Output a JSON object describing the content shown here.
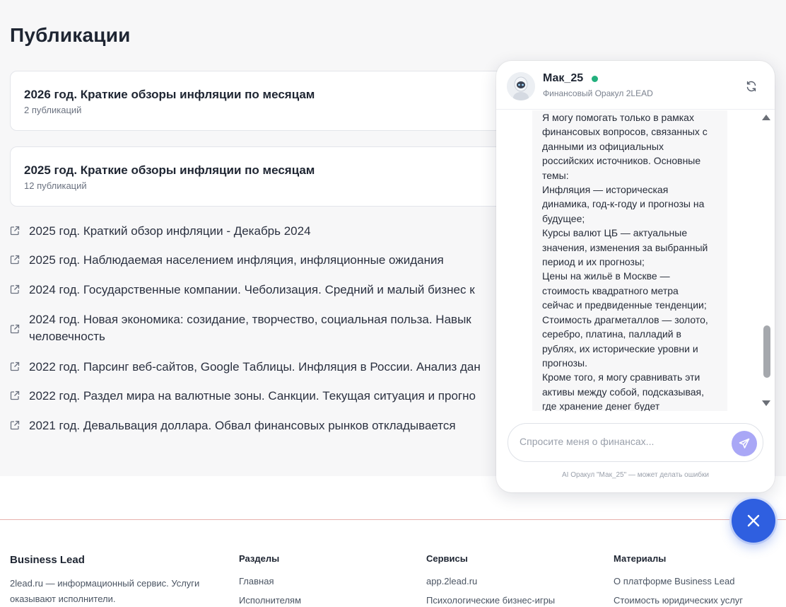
{
  "page": {
    "title": "Публикации",
    "cards": [
      {
        "title": "2026 год. Краткие обзоры инфляции по месяцам",
        "count": "2 публикаций"
      },
      {
        "title": "2025 год. Краткие обзоры инфляции по месяцам",
        "count": "12 публикаций"
      }
    ],
    "links": [
      "2025 год. Краткий обзор инфляции - Декабрь 2024",
      "2025 год. Наблюдаемая населением инфляция, инфляционные ожидания",
      "2024 год. Государственные компании. Чеболизация. Средний и малый бизнес к",
      "2024 год. Новая экономика: созидание, творчество, социальная польза. Навык",
      "человечность",
      "2022 год. Парсинг веб-сайтов, Google Таблицы. Инфляция в России. Анализ дан",
      "2022 год. Раздел мира на валютные зоны. Санкции. Текущая ситуация и прогно",
      "2021 год. Девальвация доллара. Обвал финансовых рынков откладывается"
    ]
  },
  "footer": {
    "brand": "Business Lead",
    "description": "2lead.ru — информационный сервис. Услуги оказывают исполнители.",
    "sections": {
      "heading": "Разделы",
      "links": [
        "Главная",
        "Исполнителям"
      ]
    },
    "services": {
      "heading": "Сервисы",
      "links": [
        "app.2lead.ru",
        "Психологические бизнес-игры"
      ]
    },
    "materials": {
      "heading": "Материалы",
      "links": [
        "О платформе Business Lead",
        "Стоимость юридических услуг"
      ]
    }
  },
  "chat": {
    "name": "Мак_25",
    "status": "online",
    "subtitle": "Финансовый Оракул 2LEAD",
    "message": "Я могу помогать только в рамках\nфинансовых вопросов, связанных с\nданными из официальных\nроссийских источников. Основные\nтемы:\nИнфляция — историческая\nдинамика, год-к-году и прогнозы на\nбудущее;\nКурсы валют ЦБ — актуальные\nзначения, изменения за выбранный\nпериод и их прогнозы;\nЦены на жильё в Москве —\nстоимость квадратного метра\nсейчас и предвиденные тенденции;\nСтоимость драгметаллов — золото,\nсеребро, платина, палладий в\nрублях, их исторические уровни и\nпрогнозы.\nКроме того, я могу сравнивать эти\nактивы между собой, подсказывая,\nгде хранение денег будет",
    "input_placeholder": "Спросите меня о финансах...",
    "input_value": "",
    "disclaimer": "AI Оракул \"Мак_25\" — может делать ошибки"
  },
  "colors": {
    "accent": "#2f5fe0",
    "send_button": "#a9a7f6",
    "online": "#22b07d",
    "footer_rule": "#e8b1ad"
  },
  "icons": {
    "link": "external-link-icon",
    "refresh": "refresh-icon",
    "send": "send-icon",
    "close": "close-icon"
  }
}
